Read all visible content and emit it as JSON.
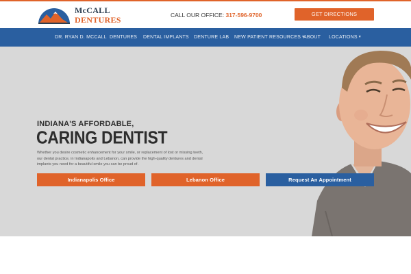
{
  "brand": {
    "name_line1": "McCALL",
    "name_line2": "DENTURES",
    "accent_color": "#e0632a",
    "nav_color": "#2a5fa0"
  },
  "header": {
    "call_label": "CALL OUR OFFICE:",
    "phone": "317-596-9700",
    "directions_label": "GET DIRECTIONS"
  },
  "nav": {
    "items": [
      {
        "label": "DR. RYAN D. MCCALL"
      },
      {
        "label": "DENTURES"
      },
      {
        "label": "DENTAL IMPLANTS"
      },
      {
        "label": "DENTURE LAB"
      },
      {
        "label": "NEW PATIENT RESOURCES"
      },
      {
        "label": "ABOUT"
      },
      {
        "label": "LOCATIONS"
      }
    ],
    "dropdown_icon": "caret-down-icon"
  },
  "hero": {
    "tagline": "INDIANA'S AFFORDABLE,",
    "headline": "CARING DENTIST",
    "blurb": "Whether you desire cosmetic enhancement for your smile, or replacement of lost or missing teeth, our dental practice, in Indianapolis and Lebanon, can provide the high-quality dentures and dental implants you need for a beautiful smile you can be proud of.",
    "buttons": [
      {
        "label": "Indianapolis Office"
      },
      {
        "label": "Lebanon Office"
      },
      {
        "label": "Request An Appointment"
      }
    ]
  }
}
